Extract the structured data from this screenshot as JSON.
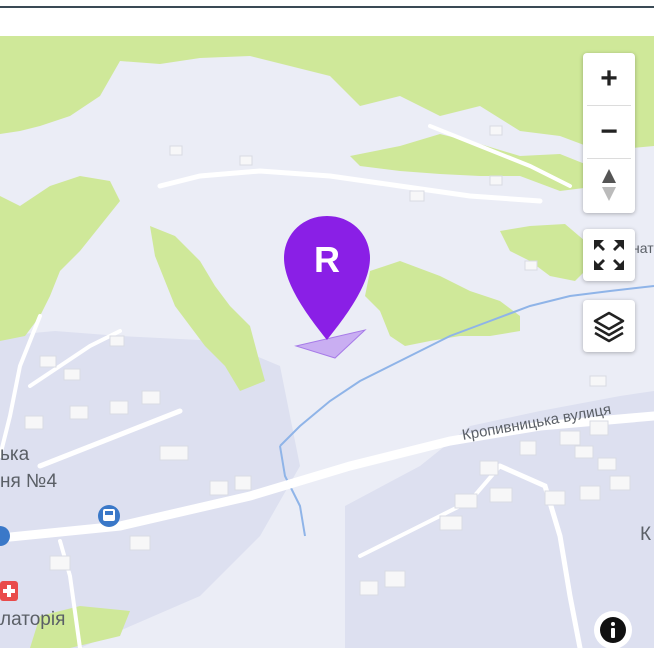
{
  "map": {
    "labels": {
      "street": "Кропивницька вулиця",
      "partial_ka": "ька",
      "partial_n4": "ня №4",
      "partial_sanatorium": "латорія",
      "partial_right_k": "К",
      "partial_right_nat": "нат"
    },
    "marker": {
      "letter": "R",
      "color": "#8a1fe6"
    },
    "controls": {
      "zoom_in": "+",
      "zoom_out": "−",
      "compass": "compass-icon",
      "fullscreen": "fullscreen-icon",
      "layers": "layers-icon",
      "info": "i"
    },
    "colors": {
      "land": "#ebedf6",
      "green": "#cfe899",
      "residential": "#dde0f0",
      "road": "#ffffff",
      "water": "#8fb4e8",
      "building": "#f7f7f8"
    }
  }
}
